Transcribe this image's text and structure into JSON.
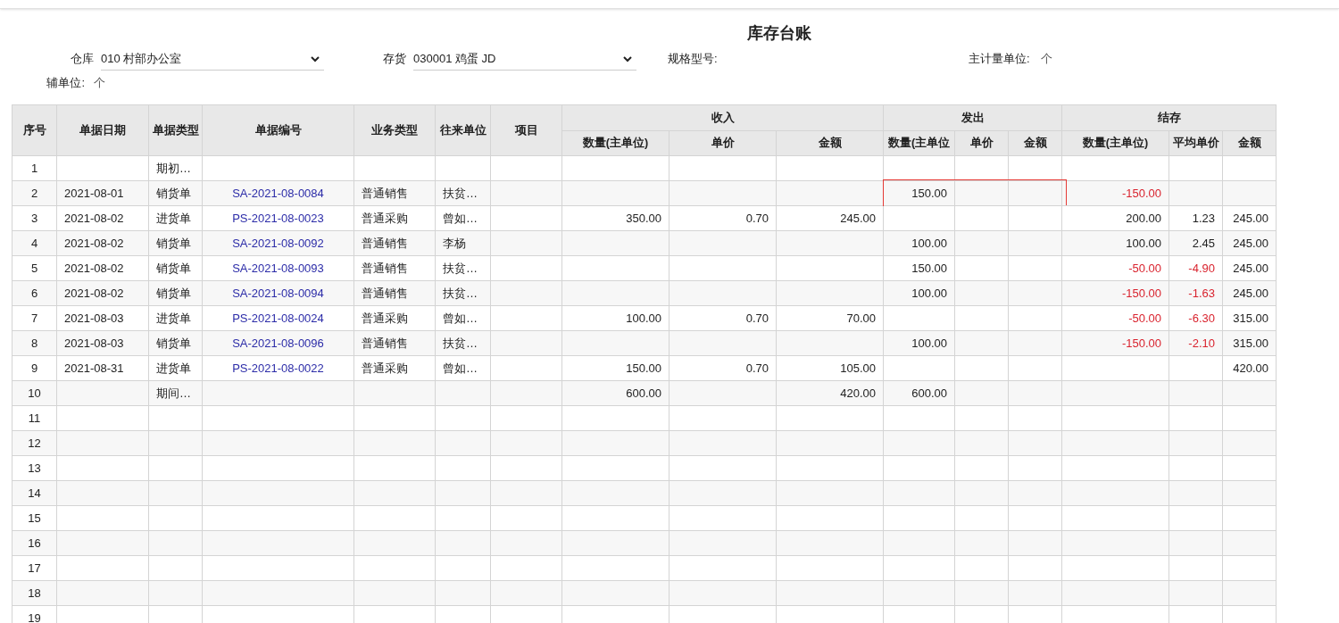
{
  "title": "库存台账",
  "filters": [
    {
      "kind": "select",
      "label": "仓库",
      "value": "010 村部办公室"
    },
    {
      "kind": "select",
      "label": "存货",
      "value": "030001 鸡蛋 JD"
    },
    {
      "kind": "text",
      "label": "规格型号:"
    },
    {
      "kind": "text",
      "label": "主计量单位:",
      "value": "个"
    }
  ],
  "aux_unit": {
    "label": "辅单位:",
    "value": "个"
  },
  "table": {
    "columns": [
      "序号",
      "单据日期",
      "单据类型",
      "单据编号",
      "业务类型",
      "往来单位",
      "项目"
    ],
    "groups": [
      {
        "label": "收入",
        "columns": [
          "数量(主单位)",
          "单价",
          "金额"
        ]
      },
      {
        "label": "发出",
        "columns": [
          "数量(主单位",
          "单价",
          "金额"
        ]
      },
      {
        "label": "结存",
        "columns": [
          "数量(主单位)",
          "平均单价",
          "金额"
        ]
      }
    ],
    "rows": [
      {
        "no": "1",
        "type": "期初…",
        "out_highlighted": false
      },
      {
        "no": "2",
        "date": "2021-08-01",
        "type": "销货单",
        "number": "SA-2021-08-0084",
        "business": "普通销售",
        "partner": "扶贫…",
        "out_qty": "150.00",
        "bal_qty": "-150.00",
        "out_highlighted": true,
        "bal_qty_negative": true
      },
      {
        "no": "3",
        "date": "2021-08-02",
        "type": "进货单",
        "number": "PS-2021-08-0023",
        "business": "普通采购",
        "partner": "曾如…",
        "in_qty": "350.00",
        "in_price": "0.70",
        "in_amount": "245.00",
        "bal_qty": "200.00",
        "bal_avg": "1.23",
        "bal_amount": "245.00",
        "out_highlighted": false,
        "bal_qty_negative": false,
        "bal_avg_negative": false
      },
      {
        "no": "4",
        "date": "2021-08-02",
        "type": "销货单",
        "number": "SA-2021-08-0092",
        "business": "普通销售",
        "partner": "李杨",
        "out_qty": "100.00",
        "bal_qty": "100.00",
        "bal_avg": "2.45",
        "bal_amount": "245.00",
        "out_highlighted": false,
        "bal_qty_negative": false,
        "bal_avg_negative": false
      },
      {
        "no": "5",
        "date": "2021-08-02",
        "type": "销货单",
        "number": "SA-2021-08-0093",
        "business": "普通销售",
        "partner": "扶贫…",
        "out_qty": "150.00",
        "bal_qty": "-50.00",
        "bal_avg": "-4.90",
        "bal_amount": "245.00",
        "out_highlighted": false,
        "bal_qty_negative": true,
        "bal_avg_negative": true
      },
      {
        "no": "6",
        "date": "2021-08-02",
        "type": "销货单",
        "number": "SA-2021-08-0094",
        "business": "普通销售",
        "partner": "扶贫…",
        "out_qty": "100.00",
        "bal_qty": "-150.00",
        "bal_avg": "-1.63",
        "bal_amount": "245.00",
        "out_highlighted": false,
        "bal_qty_negative": true,
        "bal_avg_negative": true
      },
      {
        "no": "7",
        "date": "2021-08-03",
        "type": "进货单",
        "number": "PS-2021-08-0024",
        "business": "普通采购",
        "partner": "曾如…",
        "in_qty": "100.00",
        "in_price": "0.70",
        "in_amount": "70.00",
        "bal_qty": "-50.00",
        "bal_avg": "-6.30",
        "bal_amount": "315.00",
        "out_highlighted": false,
        "bal_qty_negative": true,
        "bal_avg_negative": true
      },
      {
        "no": "8",
        "date": "2021-08-03",
        "type": "销货单",
        "number": "SA-2021-08-0096",
        "business": "普通销售",
        "partner": "扶贫…",
        "out_qty": "100.00",
        "bal_qty": "-150.00",
        "bal_avg": "-2.10",
        "bal_amount": "315.00",
        "out_highlighted": false,
        "bal_qty_negative": true,
        "bal_avg_negative": true
      },
      {
        "no": "9",
        "date": "2021-08-31",
        "type": "进货单",
        "number": "PS-2021-08-0022",
        "business": "普通采购",
        "partner": "曾如…",
        "in_qty": "150.00",
        "in_price": "0.70",
        "in_amount": "105.00",
        "bal_amount": "420.00",
        "out_highlighted": false
      },
      {
        "no": "10",
        "type": "期间…",
        "in_qty": "600.00",
        "in_amount": "420.00",
        "out_qty": "600.00",
        "out_highlighted": false
      },
      {
        "no": "11",
        "out_highlighted": false
      },
      {
        "no": "12",
        "out_highlighted": false
      },
      {
        "no": "13",
        "out_highlighted": false
      },
      {
        "no": "14",
        "out_highlighted": false
      },
      {
        "no": "15",
        "out_highlighted": false
      },
      {
        "no": "16",
        "out_highlighted": false
      },
      {
        "no": "17",
        "out_highlighted": false
      },
      {
        "no": "18",
        "out_highlighted": false
      },
      {
        "no": "19",
        "out_highlighted": false
      }
    ]
  }
}
